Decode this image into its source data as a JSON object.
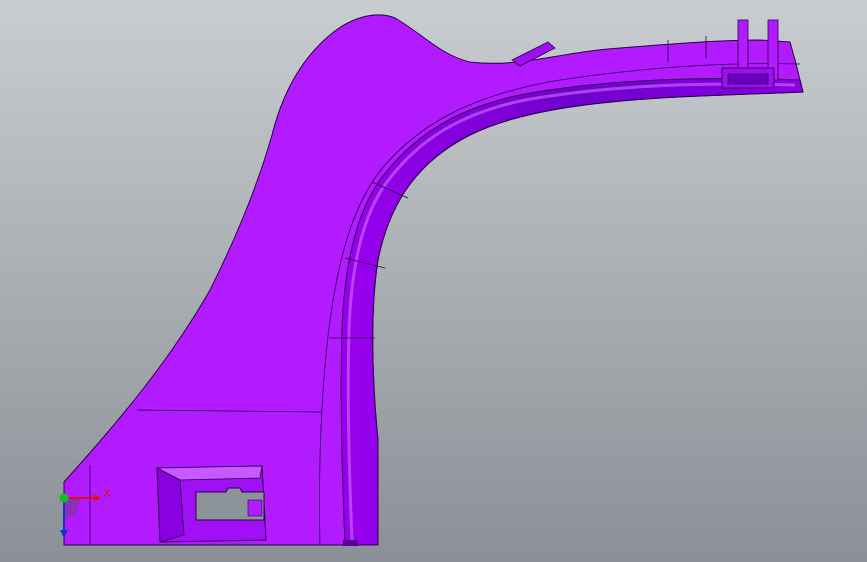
{
  "viewport": {
    "background_top": "#c9cdd1",
    "background_bottom": "#8a9096",
    "part_color": "#b21aff",
    "part_shadow": "#7a00d6",
    "part_highlight": "#c850ff",
    "edge_color": "#2a0044"
  },
  "triad": {
    "x_label": "X",
    "x_color": "#e01010",
    "y_color": "#10c020",
    "z_color": "#1030d0"
  }
}
